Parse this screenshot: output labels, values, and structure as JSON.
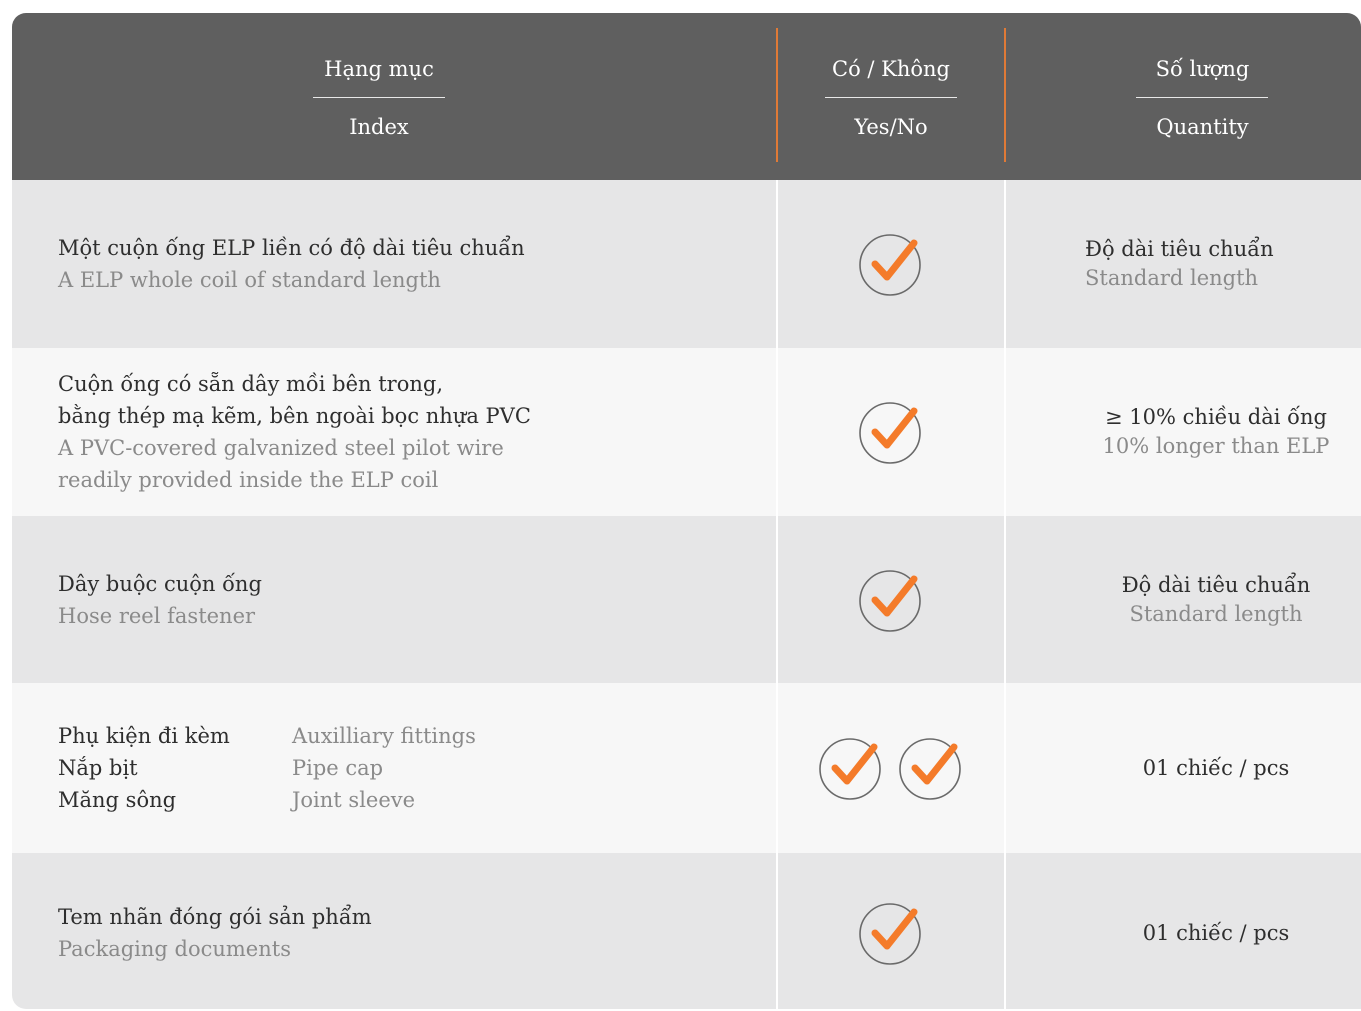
{
  "header": {
    "col1_vi": "Hạng mục",
    "col1_en": "Index",
    "col2_vi": "Có / Không",
    "col2_en": "Yes/No",
    "col3_vi": "Số lượng",
    "col3_en": "Quantity"
  },
  "rows": [
    {
      "index_vi": "Một cuộn ống ELP liền có độ dài tiêu chuẩn",
      "index_en": "A ELP whole coil of standard length",
      "checks": 1,
      "quantity_vi": "Độ dài tiêu chuẩn",
      "quantity_en": "Standard length"
    },
    {
      "index_vi_1": "Cuộn ống có sẵn dây mồi bên trong,",
      "index_vi_2": "bằng thép mạ kẽm, bên ngoài bọc nhựa PVC",
      "index_en_1": "A PVC-covered galvanized steel pilot wire",
      "index_en_2": "readily provided inside the ELP coil",
      "checks": 1,
      "quantity_vi": "≥ 10% chiều dài ống",
      "quantity_en": "10% longer than ELP"
    },
    {
      "index_vi": "Dây buộc cuộn ống",
      "index_en": "Hose reel fastener",
      "checks": 1,
      "quantity_vi": "Độ dài tiêu chuẩn",
      "quantity_en": "Standard length"
    },
    {
      "items_vi": [
        "Phụ kiện đi kèm",
        "Nắp bịt",
        "Măng sông"
      ],
      "items_en": [
        "Auxilliary fittings",
        "Pipe cap",
        "Joint sleeve"
      ],
      "checks": 2,
      "quantity": "01 chiếc / pcs"
    },
    {
      "index_vi": "Tem nhãn đóng gói sản phẩm",
      "index_en": "Packaging documents",
      "checks": 1,
      "quantity": "01 chiếc / pcs"
    }
  ],
  "colors": {
    "header_bg": "#5f5f5f",
    "accent": "#f47b2a",
    "separator": "#e07a36",
    "row_shade": "#e6e6e7",
    "row_light": "#f7f7f7"
  },
  "icons": {
    "check": "circle-check-icon"
  }
}
